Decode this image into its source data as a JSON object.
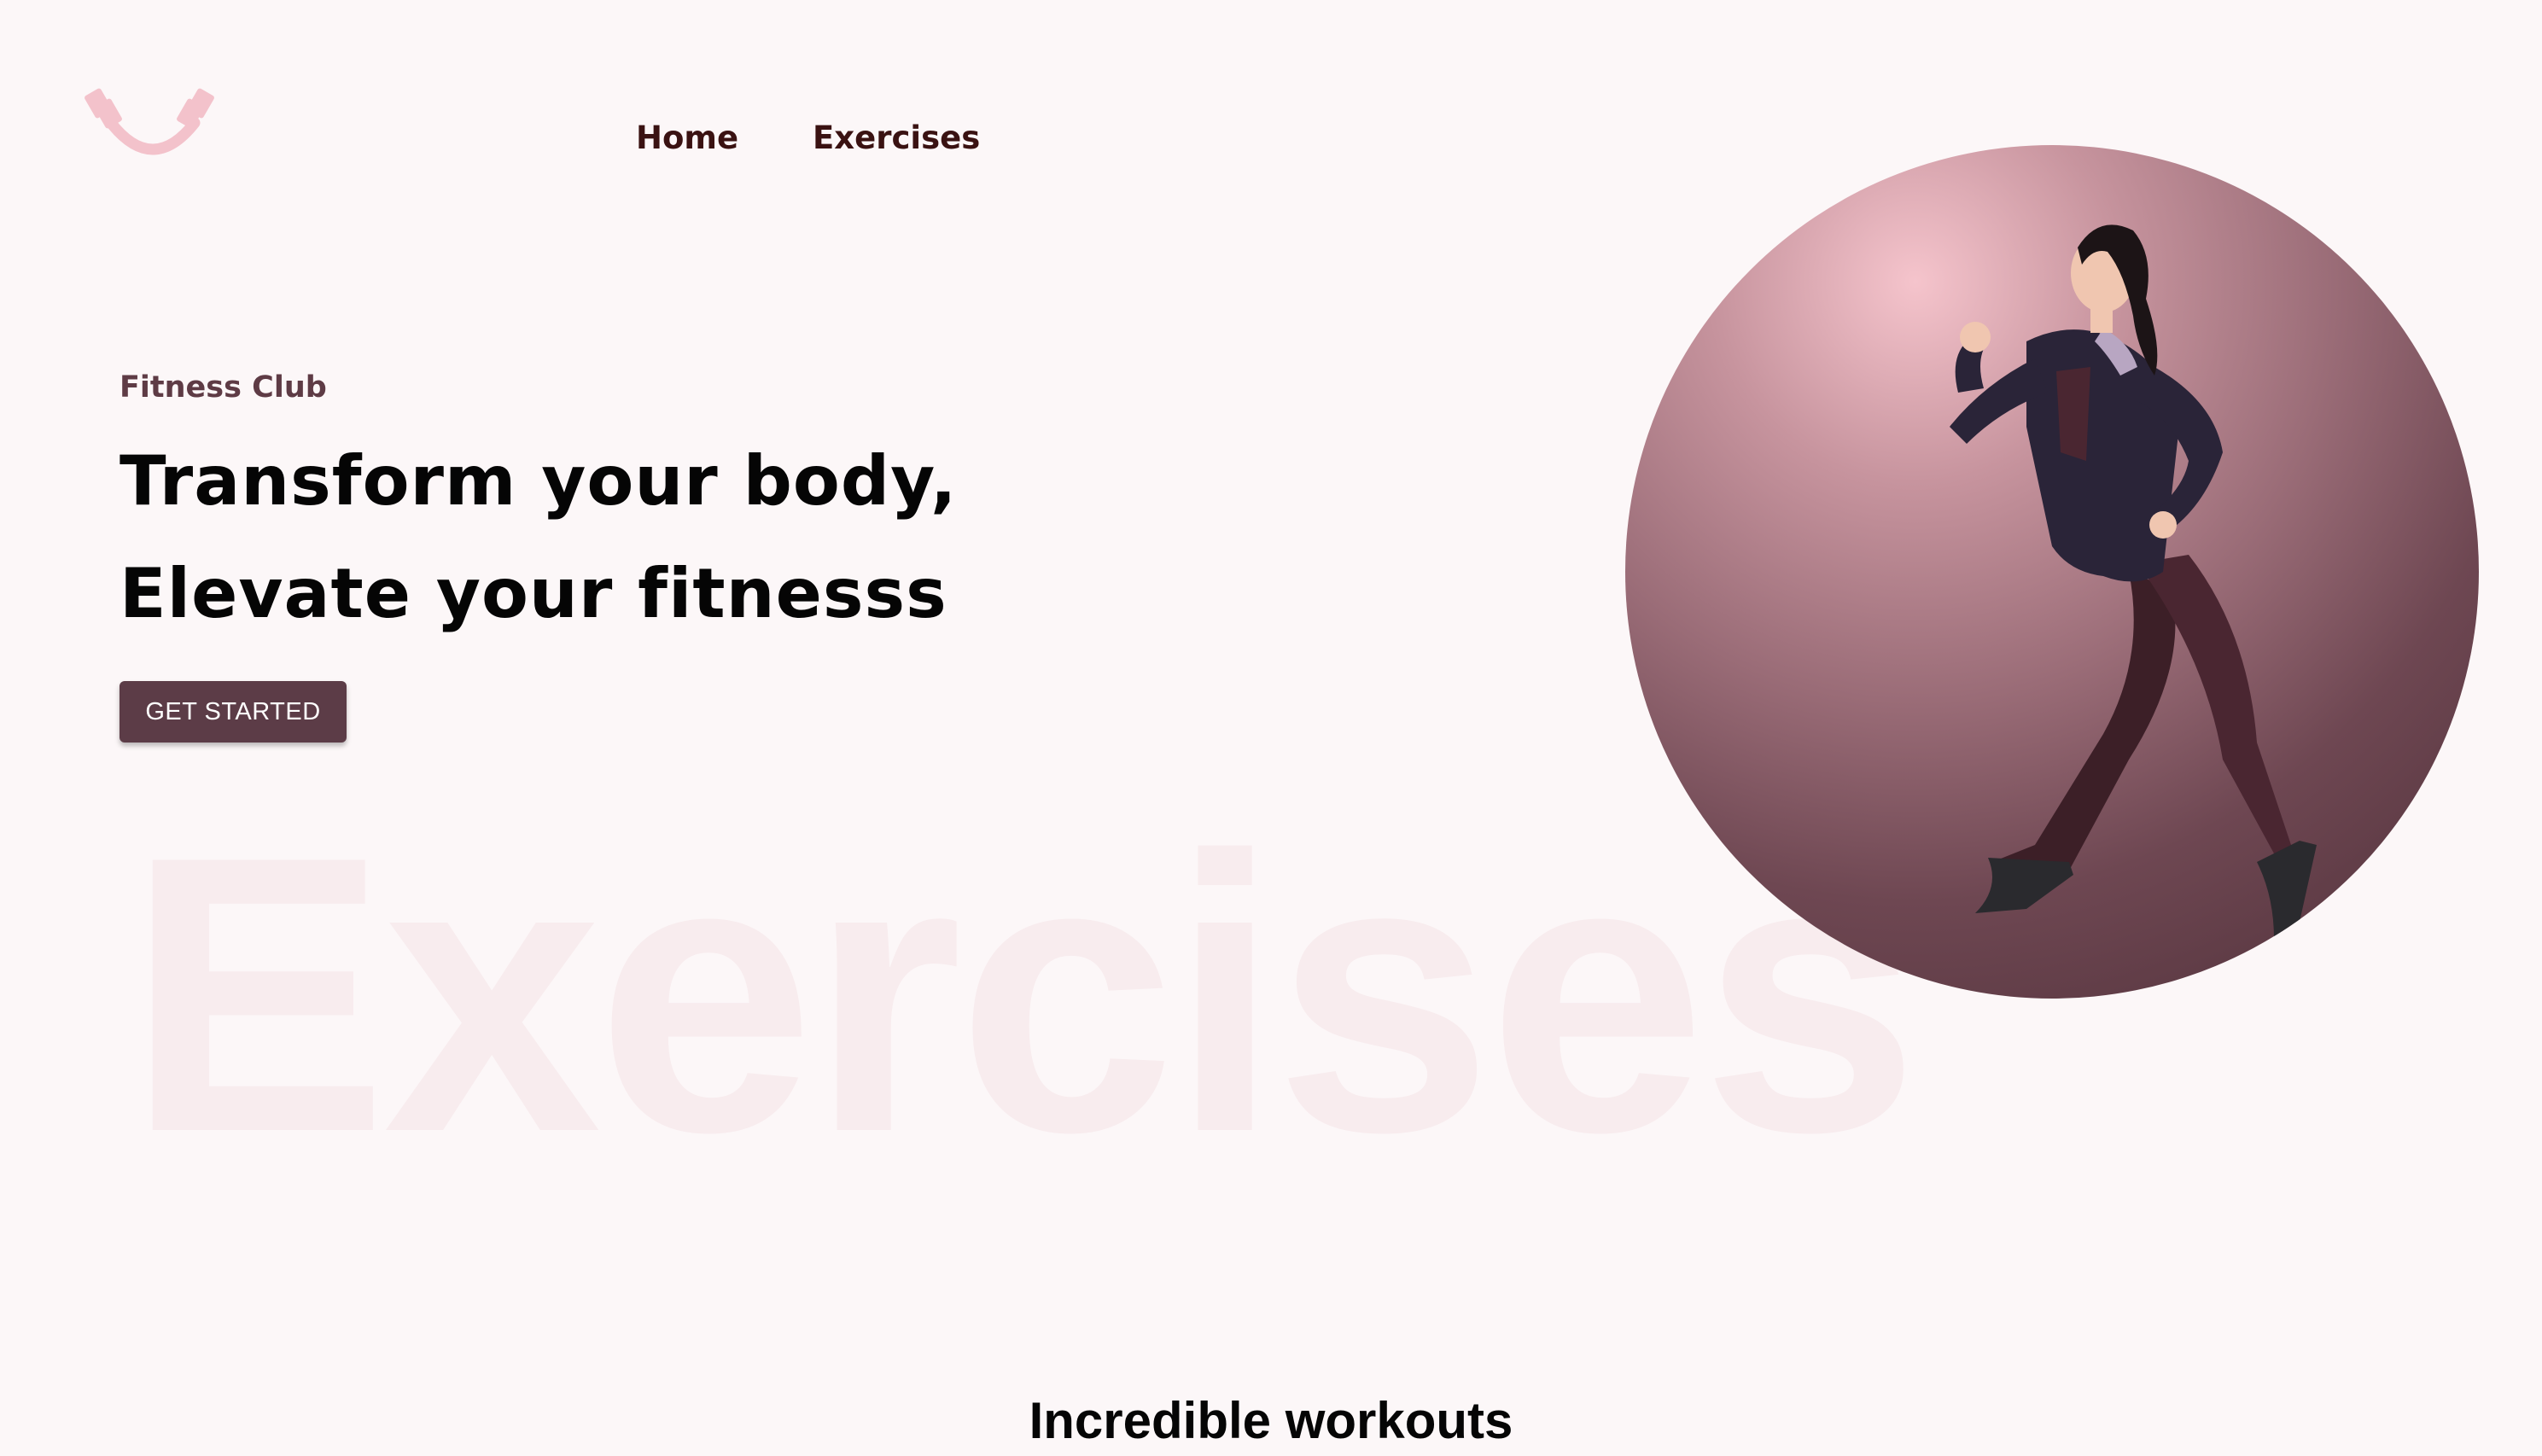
{
  "nav": {
    "home_label": "Home",
    "exercises_label": "Exercises"
  },
  "hero": {
    "kicker": "Fitness Club",
    "title_line1": "Transform your body,",
    "title_line2": "Elevate your fitnesss",
    "cta_label": "GET STARTED",
    "watermark": "Exercises"
  },
  "section": {
    "title": "Incredible workouts"
  },
  "colors": {
    "background": "#fcf7f8",
    "accent": "#5c3c47",
    "logo_pink": "#f3c2cb",
    "watermark": "#f8ecee"
  },
  "icons": {
    "logo": "dumbbell-smile-icon"
  },
  "images": {
    "hero": "woman-running-photo"
  }
}
